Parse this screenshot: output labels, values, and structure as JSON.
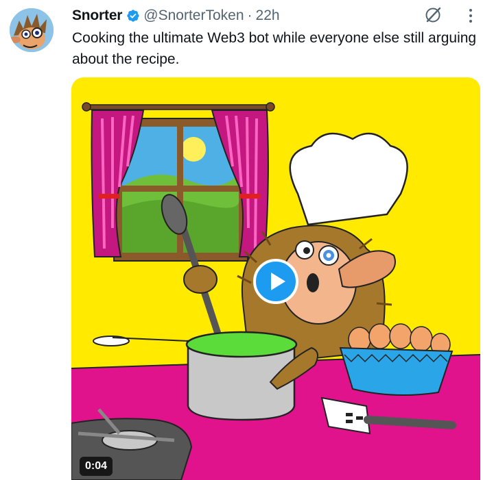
{
  "tweet": {
    "author": {
      "display_name": "Snorter",
      "handle": "@SnorterToken",
      "verified": true,
      "avatar": "cartoon-hedgehog-with-monocle"
    },
    "separator": "·",
    "timestamp": "22h",
    "text": "Cooking the ultimate Web3 bot while everyone else still arguing about the recipe.",
    "media": {
      "type": "video",
      "duration": "0:04",
      "thumbnail": "cartoon hedgehog chef stirring green soup in a pot next to a bowl of eggs, window with pink curtains"
    }
  },
  "icons": {
    "verified": "verified-badge-icon",
    "grok": "grok-icon",
    "more": "more-vertical-icon",
    "play": "play-icon"
  },
  "colors": {
    "verified_blue": "#1d9bf0",
    "text_primary": "#0f1419",
    "text_secondary": "#536471",
    "wall_yellow": "#ffea00",
    "counter_magenta": "#e0138c"
  }
}
